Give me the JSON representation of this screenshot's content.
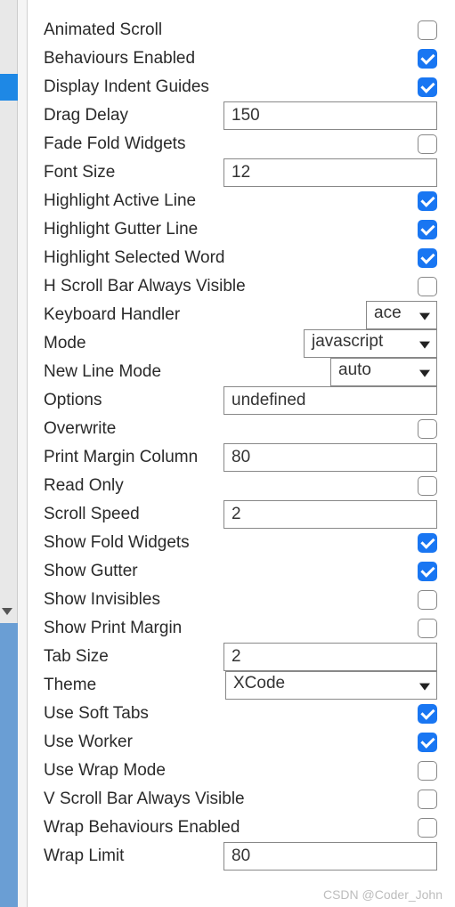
{
  "settings": [
    {
      "key": "animated-scroll",
      "label": "Animated Scroll",
      "type": "checkbox",
      "checked": false
    },
    {
      "key": "behaviours-enabled",
      "label": "Behaviours Enabled",
      "type": "checkbox",
      "checked": true
    },
    {
      "key": "display-indent-guides",
      "label": "Display Indent Guides",
      "type": "checkbox",
      "checked": true
    },
    {
      "key": "drag-delay",
      "label": "Drag Delay",
      "type": "text",
      "value": "150"
    },
    {
      "key": "fade-fold-widgets",
      "label": "Fade Fold Widgets",
      "type": "checkbox",
      "checked": false
    },
    {
      "key": "font-size",
      "label": "Font Size",
      "type": "text",
      "value": "12"
    },
    {
      "key": "highlight-active-line",
      "label": "Highlight Active Line",
      "type": "checkbox",
      "checked": true
    },
    {
      "key": "highlight-gutter-line",
      "label": "Highlight Gutter Line",
      "type": "checkbox",
      "checked": true
    },
    {
      "key": "highlight-selected-word",
      "label": "Highlight Selected Word",
      "type": "checkbox",
      "checked": true
    },
    {
      "key": "h-scroll-bar-always-visible",
      "label": "H Scroll Bar Always Visible",
      "type": "checkbox",
      "checked": false
    },
    {
      "key": "keyboard-handler",
      "label": "Keyboard Handler",
      "type": "select",
      "value": "ace",
      "widthClass": "w-ace"
    },
    {
      "key": "mode",
      "label": "Mode",
      "type": "select",
      "value": "javascript",
      "widthClass": "w-js"
    },
    {
      "key": "new-line-mode",
      "label": "New Line Mode",
      "type": "select",
      "value": "auto",
      "widthClass": "w-auto"
    },
    {
      "key": "options",
      "label": "Options",
      "type": "text",
      "value": "undefined"
    },
    {
      "key": "overwrite",
      "label": "Overwrite",
      "type": "checkbox",
      "checked": false
    },
    {
      "key": "print-margin-column",
      "label": "Print Margin Column",
      "type": "text",
      "value": "80"
    },
    {
      "key": "read-only",
      "label": "Read Only",
      "type": "checkbox",
      "checked": false
    },
    {
      "key": "scroll-speed",
      "label": "Scroll Speed",
      "type": "text",
      "value": "2"
    },
    {
      "key": "show-fold-widgets",
      "label": "Show Fold Widgets",
      "type": "checkbox",
      "checked": true
    },
    {
      "key": "show-gutter",
      "label": "Show Gutter",
      "type": "checkbox",
      "checked": true
    },
    {
      "key": "show-invisibles",
      "label": "Show Invisibles",
      "type": "checkbox",
      "checked": false
    },
    {
      "key": "show-print-margin",
      "label": "Show Print Margin",
      "type": "checkbox",
      "checked": false
    },
    {
      "key": "tab-size",
      "label": "Tab Size",
      "type": "text",
      "value": "2"
    },
    {
      "key": "theme",
      "label": "Theme",
      "type": "select",
      "value": "XCode",
      "widthClass": "w-theme"
    },
    {
      "key": "use-soft-tabs",
      "label": "Use Soft Tabs",
      "type": "checkbox",
      "checked": true
    },
    {
      "key": "use-worker",
      "label": "Use Worker",
      "type": "checkbox",
      "checked": true
    },
    {
      "key": "use-wrap-mode",
      "label": "Use Wrap Mode",
      "type": "checkbox",
      "checked": false
    },
    {
      "key": "v-scroll-bar-always-visible",
      "label": "V Scroll Bar Always Visible",
      "type": "checkbox",
      "checked": false
    },
    {
      "key": "wrap-behaviours-enabled",
      "label": "Wrap Behaviours Enabled",
      "type": "checkbox",
      "checked": false
    },
    {
      "key": "wrap-limit",
      "label": "Wrap Limit",
      "type": "text",
      "value": "80"
    }
  ],
  "watermark": "CSDN @Coder_John"
}
